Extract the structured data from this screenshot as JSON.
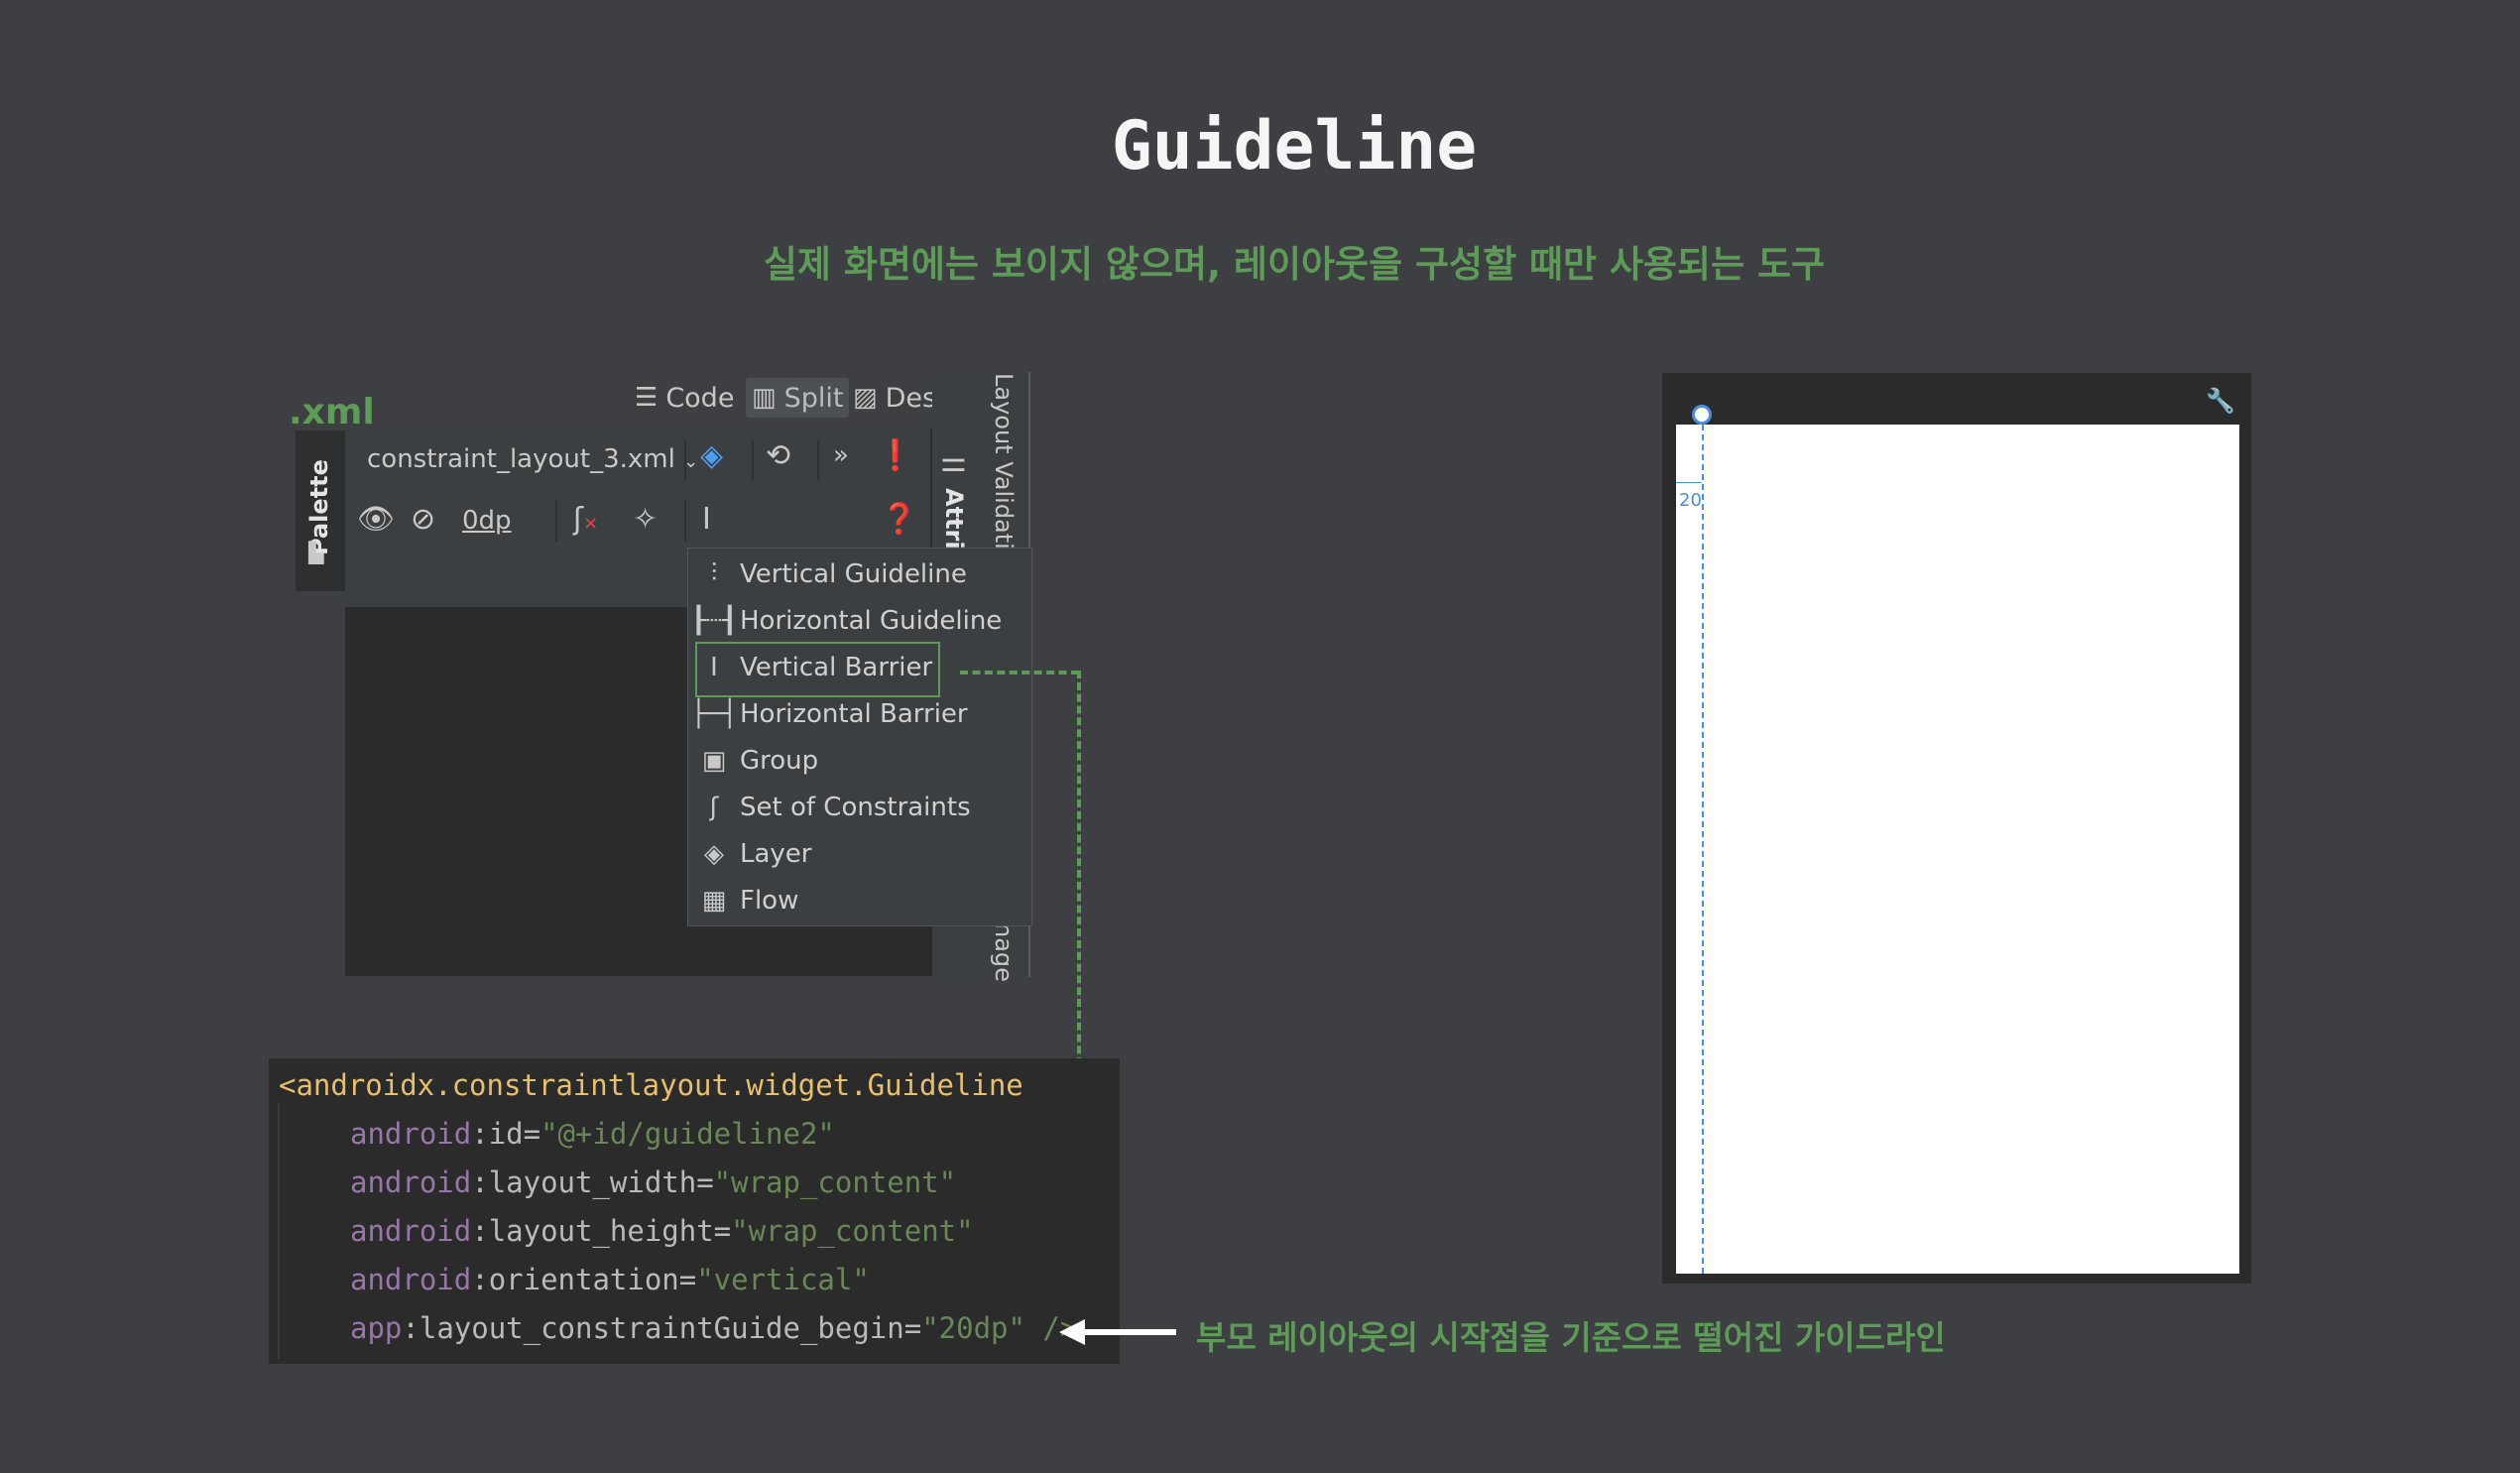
{
  "title": "Guideline",
  "subtitle": "실제 화면에는 보이지 않으며, 레이아웃을 구성할 때만 사용되는 도구",
  "xml_label": ".xml",
  "mode_tabs": [
    {
      "label": "Code",
      "icon": "lines-icon"
    },
    {
      "label": "Split",
      "icon": "split-icon"
    },
    {
      "label": "Design",
      "icon": "image-icon"
    }
  ],
  "palette": {
    "label": "Palette"
  },
  "toolbar": {
    "file_name": "constraint_layout_3.xml",
    "margin_value": "0dp",
    "more": "»"
  },
  "side_panel": {
    "layout_validation": "Layout Validatio",
    "attributes": "Attrib",
    "resource_manager": "nage"
  },
  "menu_items": [
    {
      "label": "Vertical Guideline",
      "icon": "vertical-guideline-icon"
    },
    {
      "label": "Horizontal Guideline",
      "icon": "horizontal-guideline-icon"
    },
    {
      "label": "Vertical Barrier",
      "icon": "vertical-barrier-icon"
    },
    {
      "label": "Horizontal Barrier",
      "icon": "horizontal-barrier-icon"
    },
    {
      "label": "Group",
      "icon": "group-icon"
    },
    {
      "label": "Set of Constraints",
      "icon": "constraints-icon"
    },
    {
      "label": "Layer",
      "icon": "layer-icon"
    },
    {
      "label": "Flow",
      "icon": "flow-icon"
    }
  ],
  "code": {
    "tag": "<androidx.constraintlayout.widget.Guideline",
    "lines": [
      {
        "ns": "android",
        "attr": "id",
        "value": "\"@+id/guideline2\""
      },
      {
        "ns": "android",
        "attr": "layout_width",
        "value": "\"wrap_content\""
      },
      {
        "ns": "android",
        "attr": "layout_height",
        "value": "\"wrap_content\""
      },
      {
        "ns": "android",
        "attr": "orientation",
        "value": "\"vertical\""
      },
      {
        "ns": "app",
        "attr": "layout_constraintGuide_begin",
        "value": "\"20dp\" />"
      }
    ]
  },
  "note": "부모 레이아웃의 시작점을 기준으로 떨어진 가이드라인",
  "preview": {
    "guide_label": "20"
  },
  "colors": {
    "accent_green": "#5e9b58",
    "guide_blue": "#4a90e2",
    "background": "#3d3f42"
  }
}
